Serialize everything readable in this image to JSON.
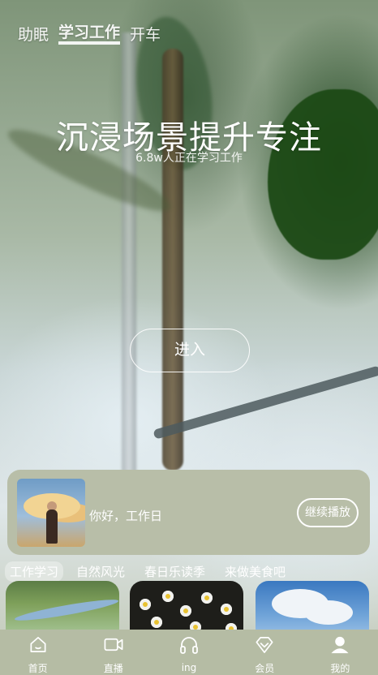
{
  "top_tabs": [
    {
      "label": "助眠",
      "active": false
    },
    {
      "label": "学习工作",
      "active": true
    },
    {
      "label": "开车",
      "active": false
    }
  ],
  "hero": {
    "title": "沉浸场景提升专注",
    "subtitle": "6.8w人正在学习工作",
    "enter_label": "进入"
  },
  "continue_card": {
    "greeting": "你好，工作日",
    "resume_label": "继续播放"
  },
  "categories": [
    {
      "label": "工作学习",
      "active": true
    },
    {
      "label": "自然风光",
      "active": false
    },
    {
      "label": "春日乐读季",
      "active": false
    },
    {
      "label": "来做美食吧",
      "active": false
    }
  ],
  "bottom_nav": [
    {
      "label": "首页",
      "icon": "home-icon"
    },
    {
      "label": "直播",
      "icon": "video-icon"
    },
    {
      "label": "ing",
      "icon": "headphones-icon"
    },
    {
      "label": "会员",
      "icon": "diamond-icon"
    },
    {
      "label": "我的",
      "icon": "user-icon"
    }
  ],
  "colors": {
    "card_bg": "#b8bea8",
    "nav_bg": "#b5bca4",
    "text": "#ffffff"
  }
}
